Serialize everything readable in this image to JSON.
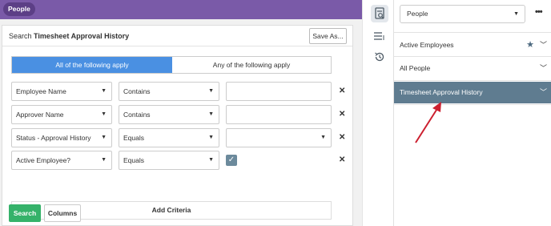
{
  "topbar": {
    "pill": "People"
  },
  "search": {
    "prefix": "Search",
    "name": "Timesheet Approval History",
    "save_label": "Save As..."
  },
  "toggle": {
    "all": "All of the following apply",
    "any": "Any of the following apply"
  },
  "criteria": [
    {
      "field": "Employee Name",
      "operator": "Contains",
      "value": ""
    },
    {
      "field": "Approver Name",
      "operator": "Contains",
      "value": ""
    },
    {
      "field": "Status - Approval History",
      "operator": "Equals",
      "value": ""
    },
    {
      "field": "Active Employee?",
      "operator": "Equals",
      "checked": true
    }
  ],
  "buttons": {
    "add_criteria": "Add Criteria",
    "search": "Search",
    "columns": "Columns"
  },
  "side": {
    "select_value": "People",
    "items": [
      {
        "label": "Active Employees",
        "starred": true
      },
      {
        "label": "All People"
      },
      {
        "label": "Timesheet Approval History",
        "active": true
      }
    ]
  },
  "colors": {
    "topbar": "#7a5aa8",
    "accent_blue": "#4a90e2",
    "search_green": "#35b26a",
    "active_item": "#5f7c90",
    "annotation_arrow": "#cc1f2f"
  }
}
